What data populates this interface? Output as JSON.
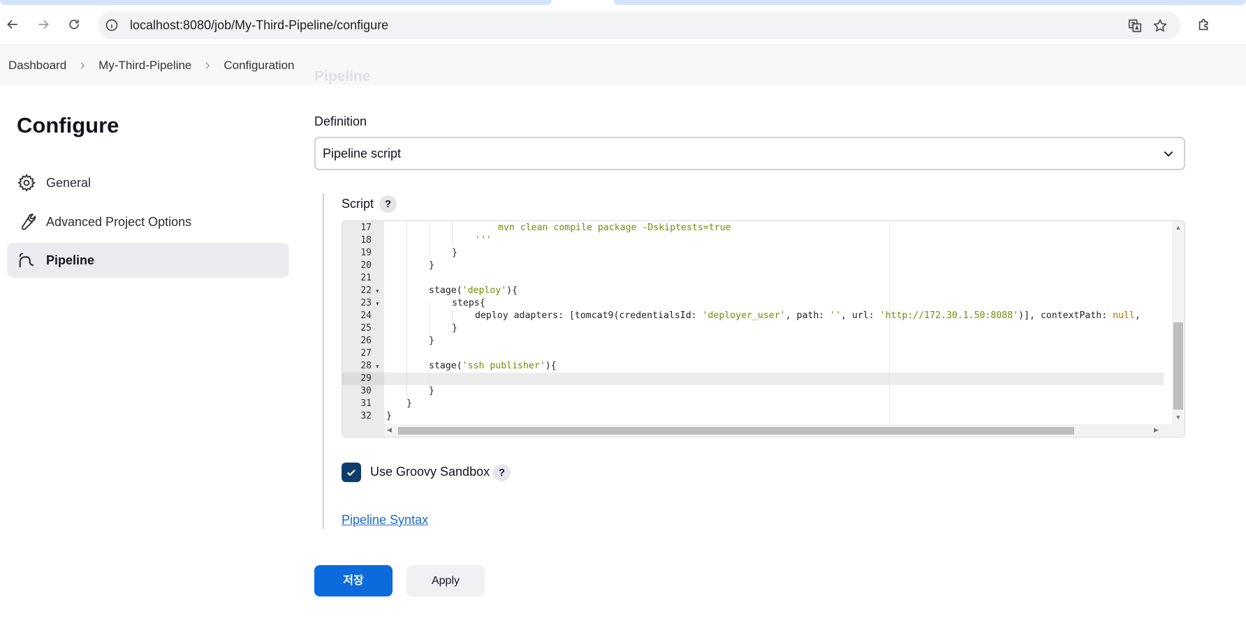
{
  "browser": {
    "url": "localhost:8080/job/My-Third-Pipeline/configure"
  },
  "breadcrumb": {
    "items": [
      "Dashboard",
      "My-Third-Pipeline",
      "Configuration"
    ]
  },
  "ghost_section_title": "Pipeline",
  "sidebar": {
    "title": "Configure",
    "items": [
      {
        "label": "General",
        "icon": "gear-icon"
      },
      {
        "label": "Advanced Project Options",
        "icon": "wrench-icon"
      },
      {
        "label": "Pipeline",
        "icon": "pipeline-icon",
        "active": true
      }
    ]
  },
  "definition": {
    "label": "Definition",
    "selected": "Pipeline script"
  },
  "script": {
    "label": "Script",
    "help": "?",
    "line_numbers": [
      "17",
      "18",
      "19",
      "20",
      "21",
      "22",
      "23",
      "24",
      "25",
      "26",
      "27",
      "28",
      "29",
      "30",
      "31",
      "32"
    ],
    "active_line": "29",
    "lines": {
      "l17": "mvn clean compile package -Dskiptests=true",
      "l18": "'''",
      "l19": "}",
      "l20": "}",
      "l22a": "stage(",
      "l22b": "'deploy'",
      "l22c": "){",
      "l23": "steps{",
      "l24a": "deploy adapters: [tomcat9(credentialsId: ",
      "l24b": "'deployer_user'",
      "l24c": ", path: ",
      "l24d": "''",
      "l24e": ", url: ",
      "l24f": "'http://172.30.1.50:8088'",
      "l24g": ")], contextPath: ",
      "l24h": "null",
      "l24i": ",",
      "l25": "}",
      "l26": "}",
      "l28a": "stage(",
      "l28b": "'ssh publisher'",
      "l28c": "){",
      "l30": "}",
      "l31": "}",
      "l32": "}"
    }
  },
  "sandbox": {
    "label": "Use Groovy Sandbox",
    "checked": true,
    "help": "?"
  },
  "pipeline_syntax_link": "Pipeline Syntax",
  "buttons": {
    "save": "저장",
    "apply": "Apply"
  },
  "colors": {
    "primary": "#0b6bdc",
    "checkbox": "#0f3d6b",
    "link": "#1a69d6",
    "string": "#6f8f00",
    "null_keyword": "#c76b00"
  }
}
